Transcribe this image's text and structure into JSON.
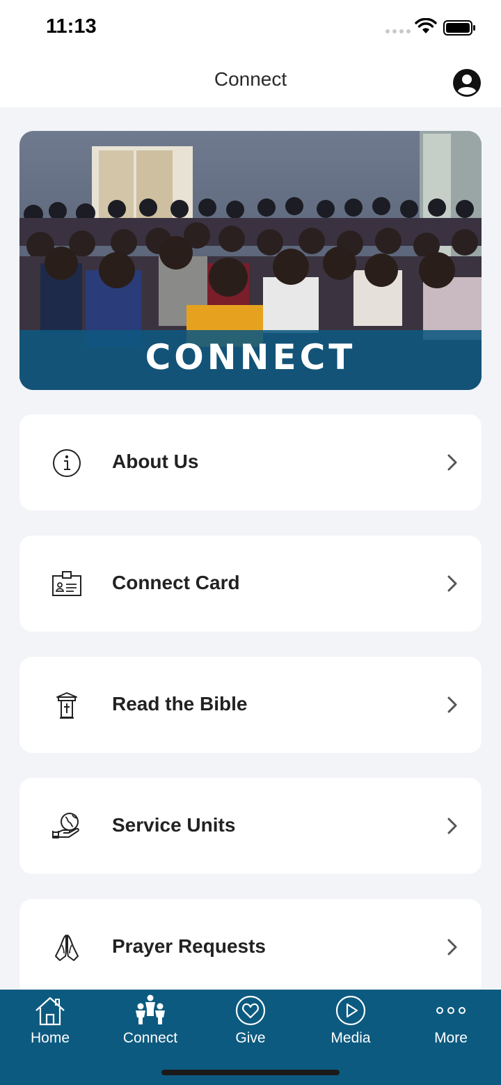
{
  "status_bar": {
    "time": "11:13"
  },
  "header": {
    "title": "Connect"
  },
  "banner": {
    "title": "CONNECT"
  },
  "menu": [
    {
      "label": "About Us",
      "icon": "info-icon"
    },
    {
      "label": "Connect Card",
      "icon": "id-card-icon"
    },
    {
      "label": "Read the Bible",
      "icon": "bible-stand-icon"
    },
    {
      "label": "Service Units",
      "icon": "globe-in-hand-icon"
    },
    {
      "label": "Prayer Requests",
      "icon": "praying-hands-icon"
    }
  ],
  "tabs": [
    {
      "label": "Home",
      "icon": "home-icon"
    },
    {
      "label": "Connect",
      "icon": "people-icon"
    },
    {
      "label": "Give",
      "icon": "heart-circle-icon"
    },
    {
      "label": "Media",
      "icon": "play-circle-icon"
    },
    {
      "label": "More",
      "icon": "more-dots-icon"
    }
  ],
  "colors": {
    "primary": "#0d5a80",
    "background": "#f2f4f8",
    "card": "#ffffff"
  }
}
